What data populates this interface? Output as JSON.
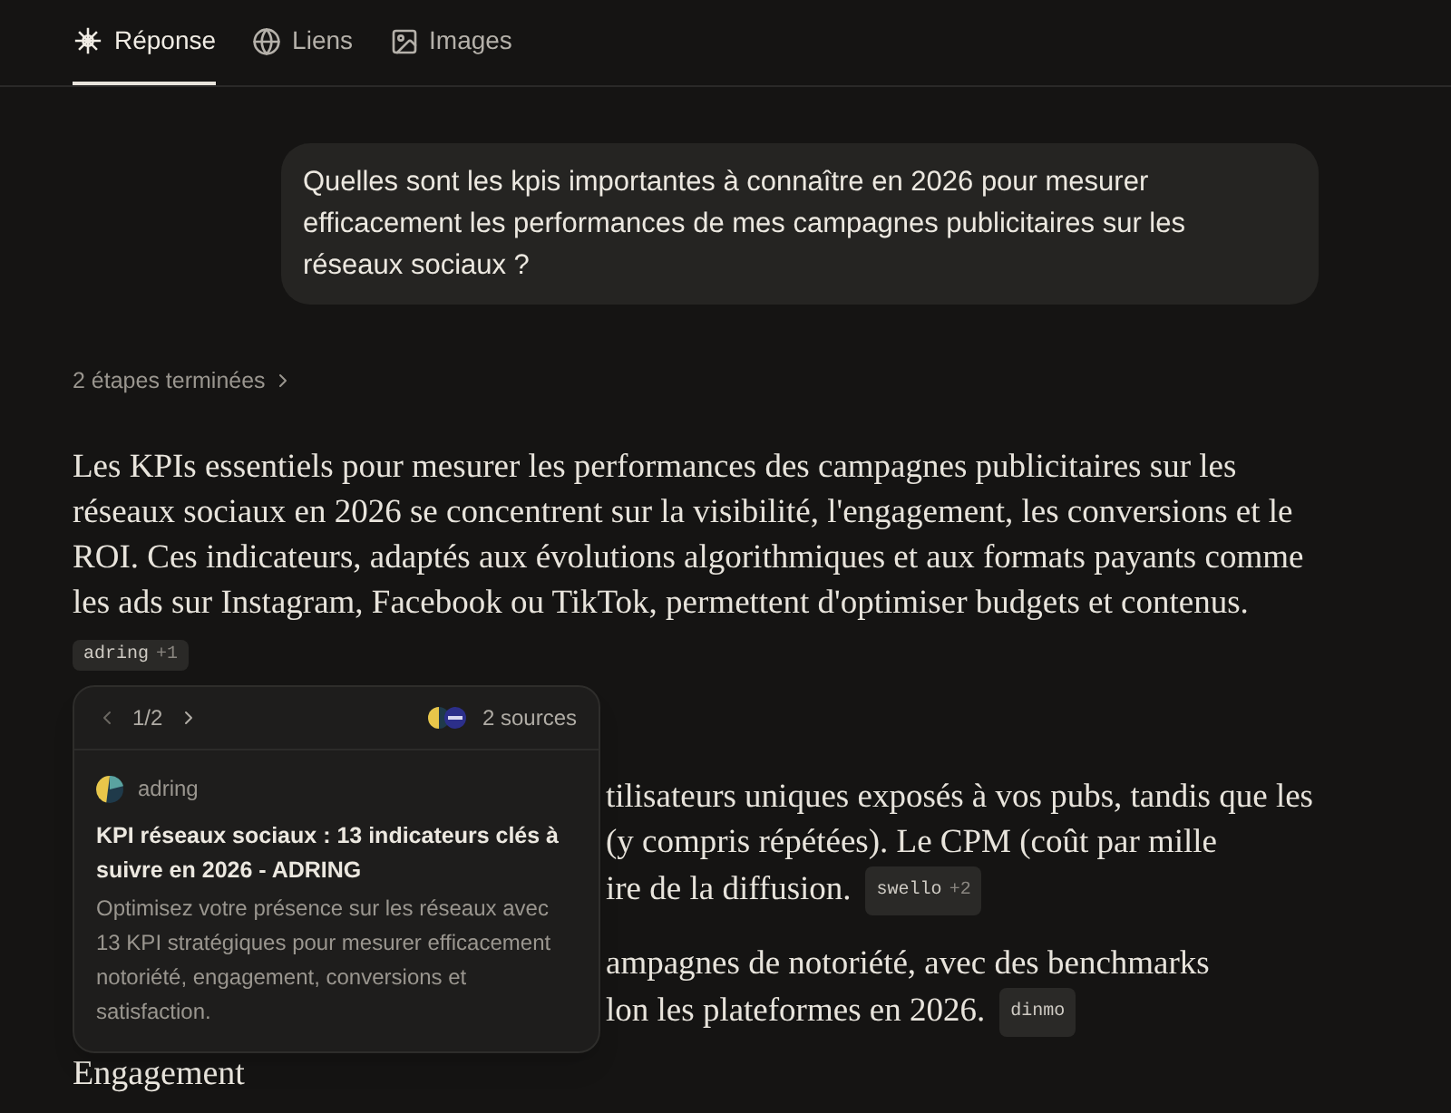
{
  "tabs": [
    {
      "label": "Réponse",
      "selected": true,
      "kind": "answer"
    },
    {
      "label": "Liens",
      "selected": false,
      "kind": "links"
    },
    {
      "label": "Images",
      "selected": false,
      "kind": "images"
    }
  ],
  "question": "Quelles sont les kpis importantes à connaître en 2026 pour mesurer efficacement les performances de mes campagnes publicitaires sur les réseaux sociaux ?",
  "steps": "2 étapes terminées",
  "intro": {
    "text": "Les KPIs essentiels pour mesurer les performances des campagnes publicitaires sur les réseaux sociaux en 2026 se concentrent sur la visibilité, l'engagement, les conversions et le ROI. Ces indicateurs, adaptés aux évolutions algorithmiques et aux formats payants comme les ads sur Instagram, Facebook ou TikTok, permettent d'optimiser budgets et contenus.",
    "citation": {
      "name": "adring",
      "more": "+1"
    }
  },
  "paragraphs": [
    {
      "lines": [
        "tilisateurs uniques exposés à vos pubs, tandis que les",
        "(y compris répétées). Le CPM (coût par mille",
        "ire de la diffusion."
      ],
      "citation": {
        "name": "swello",
        "more": "+2"
      }
    },
    {
      "lines": [
        "ampagnes de notoriété, avec des benchmarks",
        "lon les plateformes en 2026."
      ],
      "citation": {
        "name": "dinmo"
      }
    }
  ],
  "heading": "Engagement",
  "popover": {
    "page": "1/2",
    "sources_count": "2 sources",
    "source": "adring",
    "title": "KPI réseaux sociaux : 13 indicateurs clés à suivre en 2026 - ADRING",
    "description": "Optimisez votre présence sur les réseaux avec 13 KPI stratégiques pour mesurer efficacement notoriété, engagement, conversions et satisfaction."
  }
}
